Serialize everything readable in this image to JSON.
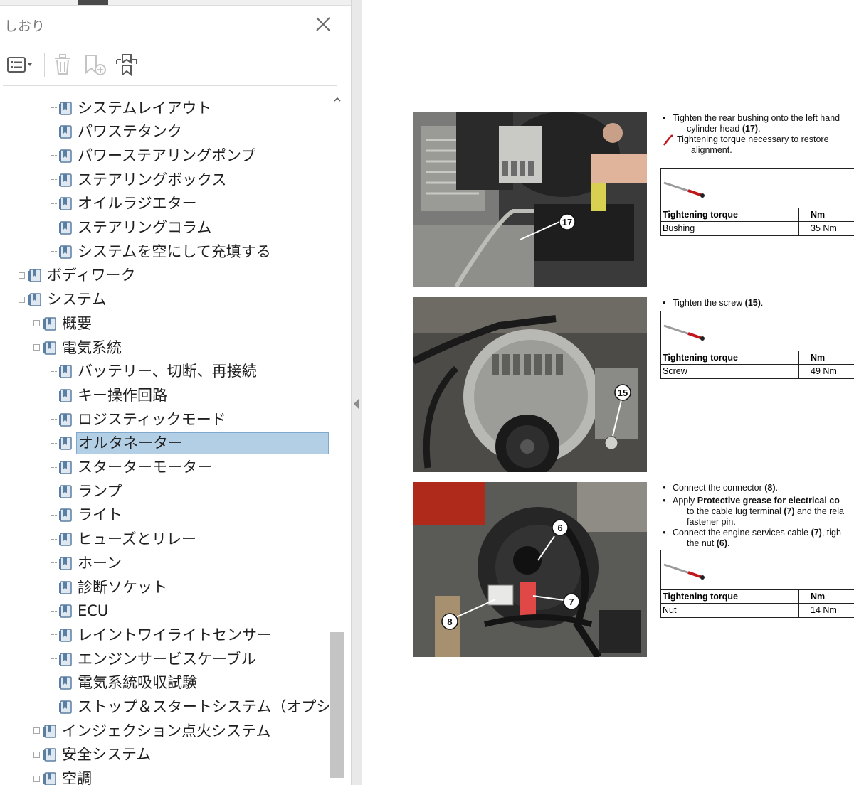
{
  "panel": {
    "title": "しおり",
    "toolbar": {
      "options_icon": "list-options-icon",
      "delete_icon": "trash-icon",
      "new_bookmark_icon": "add-bookmark-icon",
      "expand_icon": "expand-bookmark-icon"
    },
    "tree": [
      {
        "label": "システムレイアウト",
        "level": 3,
        "expander": false
      },
      {
        "label": "パワステタンク",
        "level": 3,
        "expander": false
      },
      {
        "label": "パワーステアリングポンプ",
        "level": 3,
        "expander": false
      },
      {
        "label": "ステアリングボックス",
        "level": 3,
        "expander": false
      },
      {
        "label": "オイルラジエター",
        "level": 3,
        "expander": false
      },
      {
        "label": "ステアリングコラム",
        "level": 3,
        "expander": false
      },
      {
        "label": "システムを空にして充填する",
        "level": 3,
        "expander": false
      },
      {
        "label": "ボディワーク",
        "level": 1,
        "expander": true
      },
      {
        "label": "システム",
        "level": 1,
        "expander": true
      },
      {
        "label": "概要",
        "level": 2,
        "expander": true
      },
      {
        "label": "電気系統",
        "level": 2,
        "expander": true
      },
      {
        "label": "バッテリー、切断、再接続",
        "level": 3,
        "expander": false
      },
      {
        "label": "キー操作回路",
        "level": 3,
        "expander": false
      },
      {
        "label": "ロジスティックモード",
        "level": 3,
        "expander": false
      },
      {
        "label": "オルタネーター",
        "level": 3,
        "expander": false,
        "selected": true
      },
      {
        "label": "スターターモーター",
        "level": 3,
        "expander": false
      },
      {
        "label": "ランプ",
        "level": 3,
        "expander": false
      },
      {
        "label": "ライト",
        "level": 3,
        "expander": false
      },
      {
        "label": "ヒューズとリレー",
        "level": 3,
        "expander": false
      },
      {
        "label": "ホーン",
        "level": 3,
        "expander": false
      },
      {
        "label": "診断ソケット",
        "level": 3,
        "expander": false
      },
      {
        "label": "ECU",
        "level": 3,
        "expander": false
      },
      {
        "label": "レイントワイライトセンサー",
        "level": 3,
        "expander": false
      },
      {
        "label": "エンジンサービスケーブル",
        "level": 3,
        "expander": false
      },
      {
        "label": "電気系統吸収試験",
        "level": 3,
        "expander": false
      },
      {
        "label": "ストップ＆スタートシステム（オプション）",
        "level": 3,
        "expander": false
      },
      {
        "label": "インジェクション点火システム",
        "level": 2,
        "expander": true
      },
      {
        "label": "安全システム",
        "level": 2,
        "expander": true
      },
      {
        "label": "空調",
        "level": 2,
        "expander": true
      }
    ],
    "selection_color": "#b3cfe5",
    "bookmark_icon_color": "#5b7fa3"
  },
  "document": {
    "steps": [
      {
        "callouts": [
          "17"
        ],
        "instructions": [
          {
            "type": "bullet",
            "text": "Tighten the rear bushing onto the left hand"
          },
          {
            "type": "sub",
            "text": "cylinder head ",
            "bold": "(17)",
            "after": "."
          },
          {
            "type": "warn",
            "text": "Tightening torque necessary to restore"
          },
          {
            "type": "warnsub",
            "text": "alignment."
          }
        ],
        "torque": {
          "header": "Tightening torque",
          "unit": "Nm",
          "item": "Bushing",
          "value": "35 Nm"
        }
      },
      {
        "callouts": [
          "15"
        ],
        "instructions": [
          {
            "type": "bullet",
            "text": "Tighten the screw ",
            "bold": "(15)",
            "after": "."
          }
        ],
        "torque": {
          "header": "Tightening torque",
          "unit": "Nm",
          "item": "Screw",
          "value": "49 Nm"
        }
      },
      {
        "callouts": [
          "6",
          "7",
          "8"
        ],
        "instructions": [
          {
            "type": "bullet",
            "text": "Connect the connector ",
            "bold": "(8)",
            "after": "."
          },
          {
            "type": "bullet",
            "text": "Apply ",
            "bold": "Protective grease for electrical co",
            "after": ""
          },
          {
            "type": "sub",
            "text": "to the cable lug terminal ",
            "bold": "(7)",
            "after": " and the rela"
          },
          {
            "type": "sub",
            "text": "fastener pin."
          },
          {
            "type": "bullet",
            "text": "Connect the engine services cable ",
            "bold": "(7)",
            "after": ", tigh"
          },
          {
            "type": "sub",
            "text": "the nut ",
            "bold": "(6)",
            "after": "."
          }
        ],
        "torque": {
          "header": "Tightening torque",
          "unit": "Nm",
          "item": "Nut",
          "value": "14 Nm"
        }
      }
    ]
  }
}
